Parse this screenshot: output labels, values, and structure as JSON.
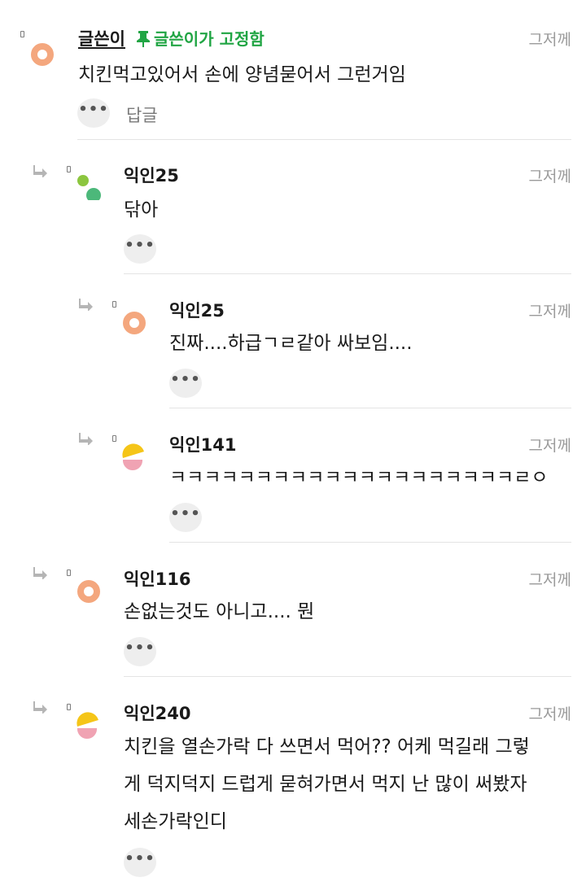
{
  "comments": [
    {
      "author": "글쓴이",
      "pinned_label": "글쓴이가 고정함",
      "time": "그저께",
      "body": [
        "치킨먹고있어서 손에 양념묻어서 그런거임"
      ],
      "more_label": "•••",
      "reply_label": "답글",
      "avatar": "orange-ring"
    },
    {
      "author": "익인25",
      "time": "그저께",
      "body": [
        "닦아"
      ],
      "more_label": "•••",
      "avatar": "green-dots"
    },
    {
      "author": "익인25",
      "time": "그저께",
      "body": [
        "진짜....하급ㄱㄹ같아 싸보임...."
      ],
      "more_label": "•••",
      "avatar": "orange-ring"
    },
    {
      "author": "익인141",
      "time": "그저께",
      "body": [
        "ㅋㅋㅋㅋㅋㅋㅋㅋㅋㅋㅋㅋㅋㅋㅋㅋㅋㅋㅋㅋㄹㅇ"
      ],
      "more_label": "•••",
      "avatar": "yellow-pink"
    },
    {
      "author": "익인116",
      "time": "그저께",
      "body": [
        "손없는것도 아니고.... 뭔"
      ],
      "more_label": "•••",
      "avatar": "orange-ring"
    },
    {
      "author": "익인240",
      "time": "그저께",
      "body": [
        "치킨을 열손가락 다 쓰면서 먹어?? 어케 먹길래 그렇",
        "게 덕지덕지 드럽게 묻혀가면서 먹지 난 많이 써봤자",
        "세손가락인디"
      ],
      "more_label": "•••",
      "avatar": "yellow-pink"
    }
  ],
  "colors": {
    "pinned": "#21a544",
    "avatar_orange": "#f4a77e",
    "avatar_green_light": "#8cc63f",
    "avatar_green_dark": "#4cb87a",
    "avatar_yellow": "#f5c518",
    "avatar_pink": "#f0a3b3",
    "meta_gray": "#9a9a9a"
  }
}
